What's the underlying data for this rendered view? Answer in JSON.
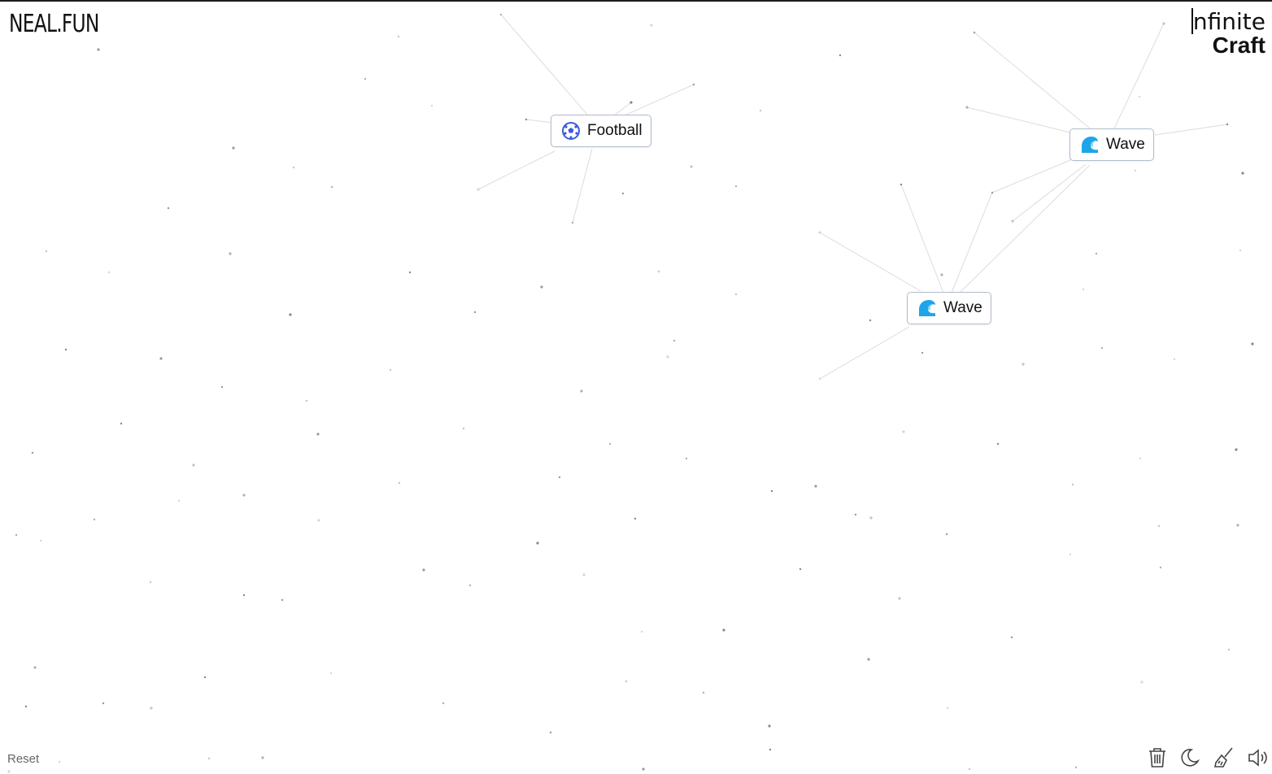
{
  "brand": {
    "text": "NEAL.FUN"
  },
  "logo": {
    "line1": "nfinite",
    "line2": "Craft"
  },
  "items": [
    {
      "label": "Football",
      "icon": "soccer-ball-icon"
    },
    {
      "label": "Wave",
      "icon": "water-wave-icon"
    },
    {
      "label": "Wave",
      "icon": "water-wave-icon"
    }
  ],
  "controls": {
    "reset_label": "Reset",
    "icons": [
      "trash-icon",
      "moon-icon",
      "broom-icon",
      "speaker-icon"
    ]
  },
  "colors": {
    "item_border": "#b0bccb",
    "wave_blue": "#1ea5e9",
    "ball_blue": "#3b5bdb"
  }
}
